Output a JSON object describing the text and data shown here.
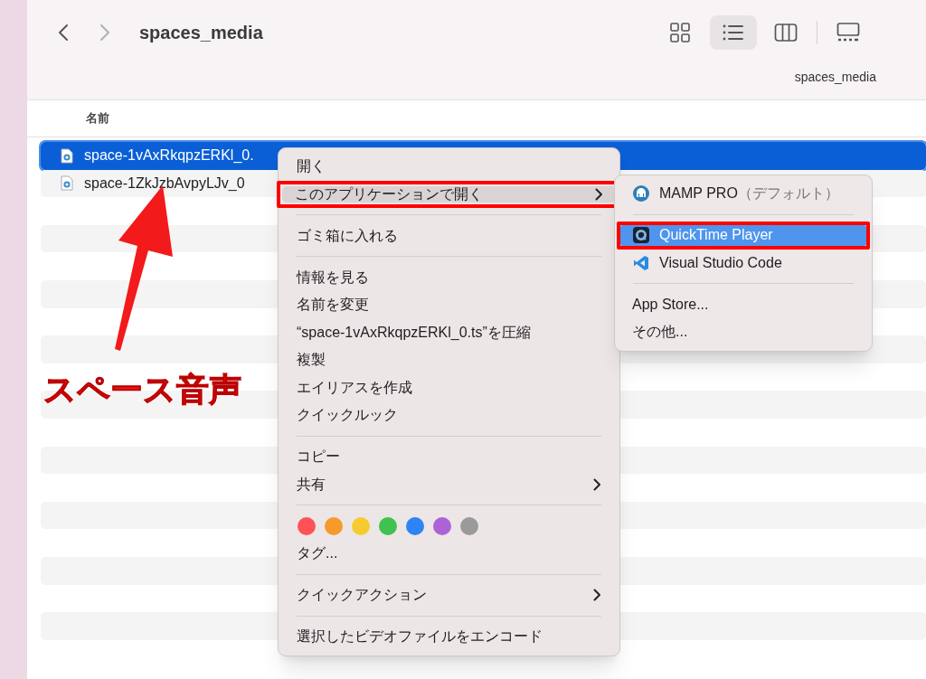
{
  "window": {
    "title": "spaces_media",
    "path_label": "spaces_media"
  },
  "toolbar": {
    "nav": [
      {
        "kind": "back",
        "disabled": false
      },
      {
        "kind": "forward",
        "disabled": true
      }
    ],
    "view_modes": [
      {
        "kind": "icons",
        "selected": false
      },
      {
        "kind": "list",
        "selected": true
      },
      {
        "kind": "columns",
        "selected": false
      },
      {
        "kind": "gallery",
        "selected": false
      }
    ]
  },
  "table": {
    "columns": [
      "名前"
    ],
    "rows": [
      {
        "name": "space-1vAxRkqpzERKl_0.",
        "selected": true
      },
      {
        "name": "space-1ZkJzbAvpyLJv_0",
        "selected": false
      }
    ]
  },
  "context_menu": {
    "items": [
      {
        "kind": "item",
        "label": "開く",
        "selected": false,
        "annotated": false
      },
      {
        "kind": "submenu",
        "label": "このアプリケーションで開く",
        "selected": true,
        "annotated": true
      },
      {
        "kind": "separator"
      },
      {
        "kind": "item",
        "label": "ゴミ箱に入れる",
        "selected": false,
        "annotated": false
      },
      {
        "kind": "separator"
      },
      {
        "kind": "item",
        "label": "情報を見る",
        "selected": false,
        "annotated": false
      },
      {
        "kind": "item",
        "label": "名前を変更",
        "selected": false,
        "annotated": false
      },
      {
        "kind": "item",
        "label": "“space-1vAxRkqpzERKl_0.ts”を圧縮",
        "selected": false,
        "annotated": false
      },
      {
        "kind": "item",
        "label": "複製",
        "selected": false,
        "annotated": false
      },
      {
        "kind": "item",
        "label": "エイリアスを作成",
        "selected": false,
        "annotated": false
      },
      {
        "kind": "item",
        "label": "クイックルック",
        "selected": false,
        "annotated": false
      },
      {
        "kind": "separator"
      },
      {
        "kind": "item",
        "label": "コピー",
        "selected": false,
        "annotated": false
      },
      {
        "kind": "submenu",
        "label": "共有",
        "selected": false,
        "annotated": false
      },
      {
        "kind": "separator"
      },
      {
        "kind": "tags",
        "tags": [
          {
            "color": "#ff5257"
          },
          {
            "color": "#f79a2d"
          },
          {
            "color": "#f6cb2f"
          },
          {
            "color": "#3fc24f"
          },
          {
            "color": "#2f84f5"
          },
          {
            "color": "#ac63d6"
          },
          {
            "color": "#9a9a9a"
          }
        ]
      },
      {
        "kind": "item",
        "label": "タグ...",
        "selected": false,
        "annotated": false
      },
      {
        "kind": "separator"
      },
      {
        "kind": "submenu",
        "label": "クイックアクション",
        "selected": false,
        "annotated": false
      },
      {
        "kind": "separator"
      },
      {
        "kind": "item",
        "label": "選択したビデオファイルをエンコード",
        "selected": false,
        "annotated": false
      }
    ]
  },
  "open_with_submenu": {
    "items": [
      {
        "kind": "app",
        "label": "MAMP PRO",
        "suffix": "（デフォルト）",
        "selected": false,
        "annotated": false
      },
      {
        "kind": "separator"
      },
      {
        "kind": "app",
        "label": "QuickTime Player",
        "selected": true,
        "annotated": true
      },
      {
        "kind": "app",
        "label": "Visual Studio Code",
        "selected": false,
        "annotated": false
      },
      {
        "kind": "separator"
      },
      {
        "kind": "item",
        "label": "App Store...",
        "selected": false,
        "annotated": false
      },
      {
        "kind": "item",
        "label": "その他...",
        "selected": false,
        "annotated": false
      }
    ]
  },
  "annotation": {
    "caption": "スペース音声"
  }
}
